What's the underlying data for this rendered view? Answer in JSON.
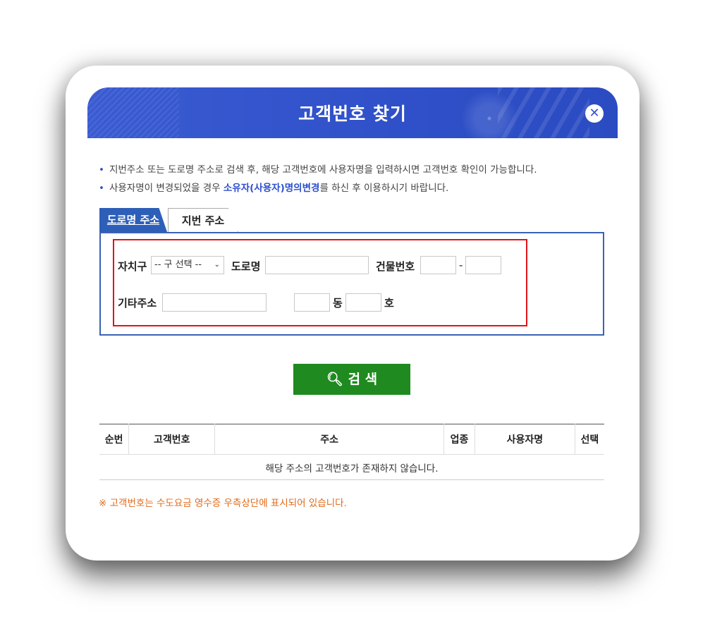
{
  "dialog": {
    "title": "고객번호 찾기",
    "close_icon": "close-icon",
    "accent_color": "#2f50c8"
  },
  "notices": [
    "지번주소 또는 도로명 주소로 검색 후, 해당 고객번호에 사용자명을 입력하시면 고객번호 확인이 가능합니다.",
    {
      "prefix": "사용자명이 변경되었을 경우 ",
      "link": "소유자(사용자)명의변경",
      "suffix": "를 하신 후 이용하시기 바랍니다."
    }
  ],
  "tabs": [
    {
      "label": "도로명 주소",
      "active": true
    },
    {
      "label": "지번 주소",
      "active": false
    }
  ],
  "form": {
    "district_label": "자치구",
    "district_select": "-- 구 선택 --",
    "road_label": "도로명",
    "road_value": "",
    "building_label": "건물번호",
    "building_main": "",
    "building_dash": "-",
    "building_sub": "",
    "other_label": "기타주소",
    "other_value": "",
    "dong_value": "",
    "dong_label": "동",
    "ho_value": "",
    "ho_label": "호"
  },
  "search_button": {
    "label": "검 색",
    "icon": "search-icon",
    "color": "#1f8a1f"
  },
  "table": {
    "headers": [
      "순번",
      "고객번호",
      "주소",
      "업종",
      "사용자명",
      "선택"
    ],
    "empty_message": "해당 주소의 고객번호가 존재하지 않습니다."
  },
  "footnote": "※ 고객번호는 수도요금 영수증 우측상단에 표시되어 있습니다."
}
